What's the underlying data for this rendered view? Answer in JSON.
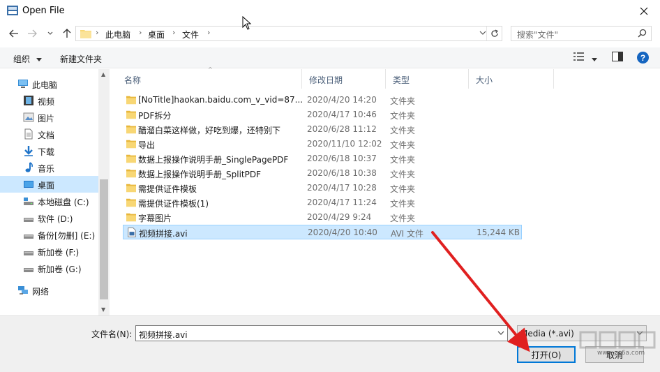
{
  "window": {
    "title": "Open File"
  },
  "address": {
    "crumbs": [
      "此电脑",
      "桌面",
      "文件"
    ]
  },
  "search": {
    "placeholder": "搜索\"文件\""
  },
  "toolbar": {
    "organize": "组织",
    "new_folder": "新建文件夹"
  },
  "sidebar": {
    "items": [
      {
        "label": "此电脑",
        "icon": "computer-icon"
      },
      {
        "label": "视频",
        "icon": "video-icon"
      },
      {
        "label": "图片",
        "icon": "pictures-icon"
      },
      {
        "label": "文档",
        "icon": "documents-icon"
      },
      {
        "label": "下载",
        "icon": "download-icon"
      },
      {
        "label": "音乐",
        "icon": "music-icon"
      },
      {
        "label": "桌面",
        "icon": "desktop-icon",
        "selected": true
      },
      {
        "label": "本地磁盘 (C:)",
        "icon": "drive-icon"
      },
      {
        "label": "软件 (D:)",
        "icon": "drive-icon"
      },
      {
        "label": "备份[勿删] (E:)",
        "icon": "drive-icon"
      },
      {
        "label": "新加卷 (F:)",
        "icon": "drive-icon"
      },
      {
        "label": "新加卷 (G:)",
        "icon": "drive-icon"
      },
      {
        "label": "网络",
        "icon": "network-icon"
      }
    ]
  },
  "filelist": {
    "columns": {
      "name": "名称",
      "date": "修改日期",
      "type": "类型",
      "size": "大小"
    },
    "rows": [
      {
        "name": "[NoTitle]haokan.baidu.com_v_vid=87...",
        "date": "2020/4/20 14:20",
        "type": "文件夹",
        "size": ""
      },
      {
        "name": "PDF拆分",
        "date": "2020/4/17 10:46",
        "type": "文件夹",
        "size": ""
      },
      {
        "name": "醋溜白菜这样做，好吃到爆，还特别下",
        "date": "2020/6/28 11:12",
        "type": "文件夹",
        "size": ""
      },
      {
        "name": "导出",
        "date": "2020/11/10 12:02",
        "type": "文件夹",
        "size": ""
      },
      {
        "name": "数据上报操作说明手册_SinglePagePDF",
        "date": "2020/6/18 10:37",
        "type": "文件夹",
        "size": ""
      },
      {
        "name": "数据上报操作说明手册_SplitPDF",
        "date": "2020/6/18 10:38",
        "type": "文件夹",
        "size": ""
      },
      {
        "name": "需提供证件模板",
        "date": "2020/4/17 10:28",
        "type": "文件夹",
        "size": ""
      },
      {
        "name": "需提供证件模板(1)",
        "date": "2020/4/17 11:24",
        "type": "文件夹",
        "size": ""
      },
      {
        "name": "字幕图片",
        "date": "2020/4/29 9:24",
        "type": "文件夹",
        "size": ""
      },
      {
        "name": "视频拼接.avi",
        "date": "2020/4/20 10:40",
        "type": "AVI 文件",
        "size": "15,244 KB",
        "selected": true
      }
    ]
  },
  "bottom": {
    "filename_label": "文件名(N):",
    "filename_value": "视频拼接.avi",
    "filter_value": "Media (*.avi)",
    "open_label": "打开(O)",
    "cancel_label": "取消"
  },
  "watermark": {
    "text": "www.pc6a.com"
  },
  "colors": {
    "accent": "#0078d7",
    "selection": "#cce8ff",
    "folder": "#f8d775",
    "arrow": "#e02020"
  }
}
